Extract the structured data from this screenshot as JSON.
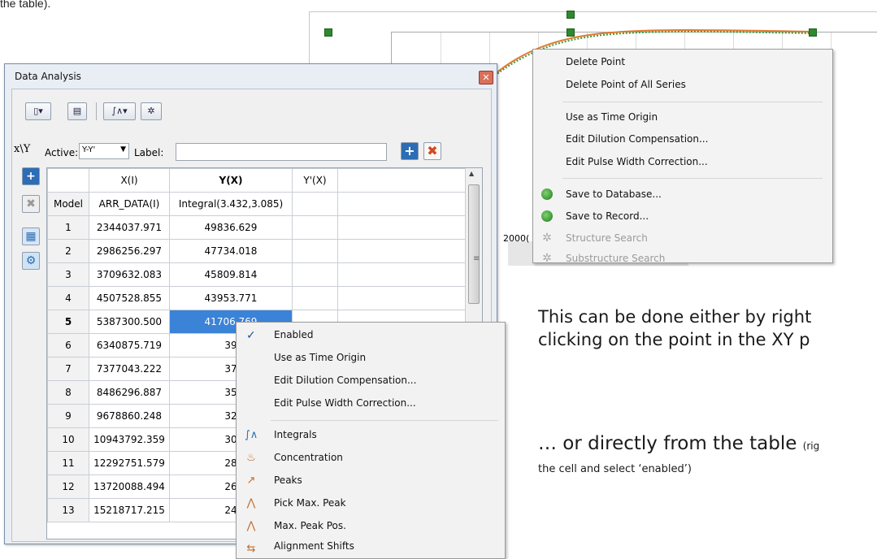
{
  "top_caption": "the table).",
  "plot": {
    "x_tick": "2000("
  },
  "plot_menu": {
    "items": [
      {
        "label": "Delete Point",
        "enabled": true
      },
      {
        "label": "Delete Point of All Series",
        "enabled": true
      },
      {
        "label": "Use as Time Origin",
        "enabled": true
      },
      {
        "label": "Edit Dilution Compensation...",
        "enabled": true
      },
      {
        "label": "Edit Pulse Width Correction...",
        "enabled": true
      },
      {
        "label": "Save to Database...",
        "enabled": true,
        "icon": "database-icon"
      },
      {
        "label": "Save to Record...",
        "enabled": true,
        "icon": "database-icon"
      },
      {
        "label": "Structure Search",
        "enabled": false,
        "icon": "structure-icon"
      },
      {
        "label": "Substructure Search",
        "enabled": false,
        "icon": "structure-icon"
      }
    ]
  },
  "slide": {
    "line1": "This can be done either by right",
    "line2": "clicking on the point in the XY p",
    "line3_main": "… or directly from the table ",
    "line3_small": "(rig",
    "line4": "the cell and select ‘enabled’)"
  },
  "window": {
    "title": "Data Analysis",
    "close_glyph": "✕",
    "active_label": "Active:",
    "active_value": "Y-Y'",
    "label_label": "Label:",
    "label_value": "",
    "xy_symbol": "x\\Y"
  },
  "table": {
    "headers": [
      "",
      "X(I)",
      "Y(X)",
      "Y'(X)",
      ""
    ],
    "subheaders": [
      "Model",
      "ARR_DATA(I)",
      "Integral(3.432,3.085)",
      "",
      ""
    ],
    "rows": [
      [
        "1",
        "2344037.971",
        "49836.629"
      ],
      [
        "2",
        "2986256.297",
        "47734.018"
      ],
      [
        "3",
        "3709632.083",
        "45809.814"
      ],
      [
        "4",
        "4507528.855",
        "43953.771"
      ],
      [
        "5",
        "5387300.500",
        "41706.769"
      ],
      [
        "6",
        "6340875.719",
        "39"
      ],
      [
        "7",
        "7377043.222",
        "37"
      ],
      [
        "8",
        "8486296.887",
        "35"
      ],
      [
        "9",
        "9678860.248",
        "32"
      ],
      [
        "10",
        "10943792.359",
        "30"
      ],
      [
        "11",
        "12292751.579",
        "28"
      ],
      [
        "12",
        "13720088.494",
        "26"
      ],
      [
        "13",
        "15218717.215",
        "24"
      ]
    ],
    "selected_row": 5
  },
  "table_menu": {
    "items": [
      {
        "label": "Enabled",
        "checked": true
      },
      {
        "label": "Use as Time Origin"
      },
      {
        "label": "Edit Dilution Compensation..."
      },
      {
        "label": "Edit Pulse Width Correction..."
      },
      {
        "label": "Integrals",
        "icon": "integrals-icon"
      },
      {
        "label": "Concentration",
        "icon": "concentration-icon"
      },
      {
        "label": "Peaks",
        "icon": "peaks-icon"
      },
      {
        "label": "Pick Max. Peak",
        "icon": "pick-max-peak-icon"
      },
      {
        "label": "Max. Peak Pos.",
        "icon": "max-peak-pos-icon"
      },
      {
        "label": "Alignment Shifts",
        "icon": "alignment-icon"
      }
    ]
  },
  "colors": {
    "selection": "#3a83d6",
    "handle_green": "#2d8a2d",
    "curve_orange": "#e07a2e"
  }
}
